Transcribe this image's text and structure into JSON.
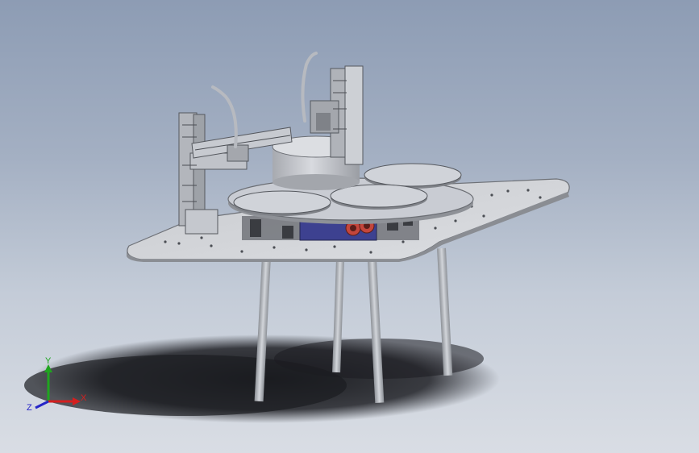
{
  "viewport": {
    "background_top": "#8d9cb4",
    "background_bottom": "#d9dde4"
  },
  "model": {
    "description_icon": "turntable-machine-assembly-icon",
    "colors": {
      "table": "#d4d6da",
      "table_edge": "#8c8f95",
      "leg": "#b8bcc2",
      "disc": "#c9ccd3",
      "drum": "#c2c5cb",
      "frame": "#9ea2a8",
      "motor": "#4a4f9c",
      "shadow": "#1e1f24"
    }
  },
  "triad": {
    "x_label": "X",
    "y_label": "Y",
    "z_label": "Z",
    "x_color": "#d41f1f",
    "y_color": "#1fa51f",
    "z_color": "#2626c8"
  }
}
